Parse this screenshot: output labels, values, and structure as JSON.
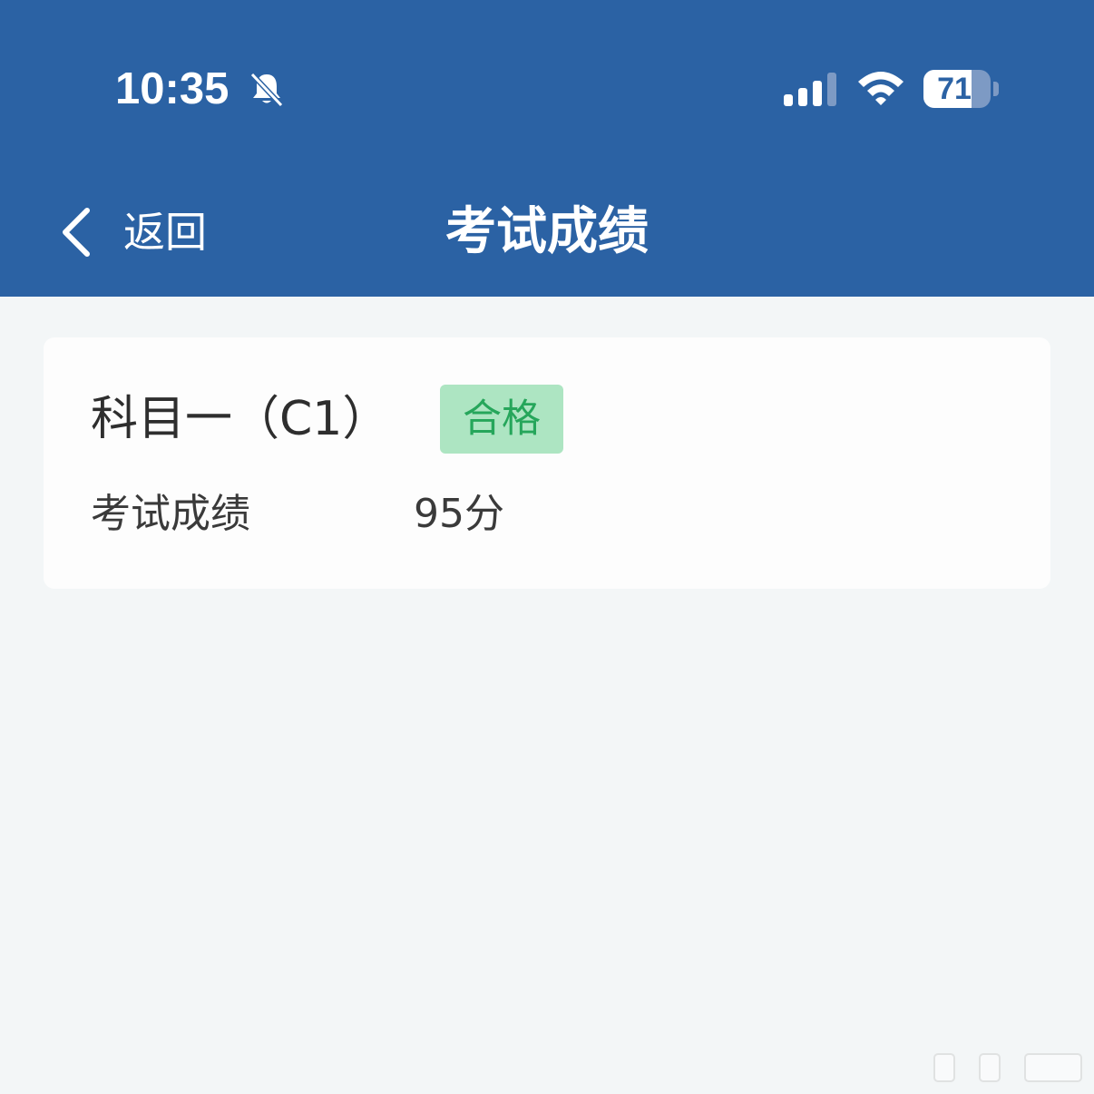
{
  "status_bar": {
    "time": "10:35",
    "battery_level": 71,
    "battery_text": "71",
    "icons": [
      "bell-slash-icon",
      "signal-icon",
      "wifi-icon",
      "battery-icon"
    ]
  },
  "nav": {
    "back_label": "返回",
    "back_icon": "chevron-left-icon",
    "title": "考试成绩"
  },
  "result_card": {
    "subject": "科目一（C1）",
    "status": "合格",
    "score_label": "考试成绩",
    "score_value": "95分"
  },
  "colors": {
    "header": "#2b62a4",
    "background": "#f3f6f7",
    "card": "#fdfdfd",
    "badge_bg": "#ade5c2",
    "badge_text": "#26a65b",
    "text": "#2e2e2e"
  }
}
